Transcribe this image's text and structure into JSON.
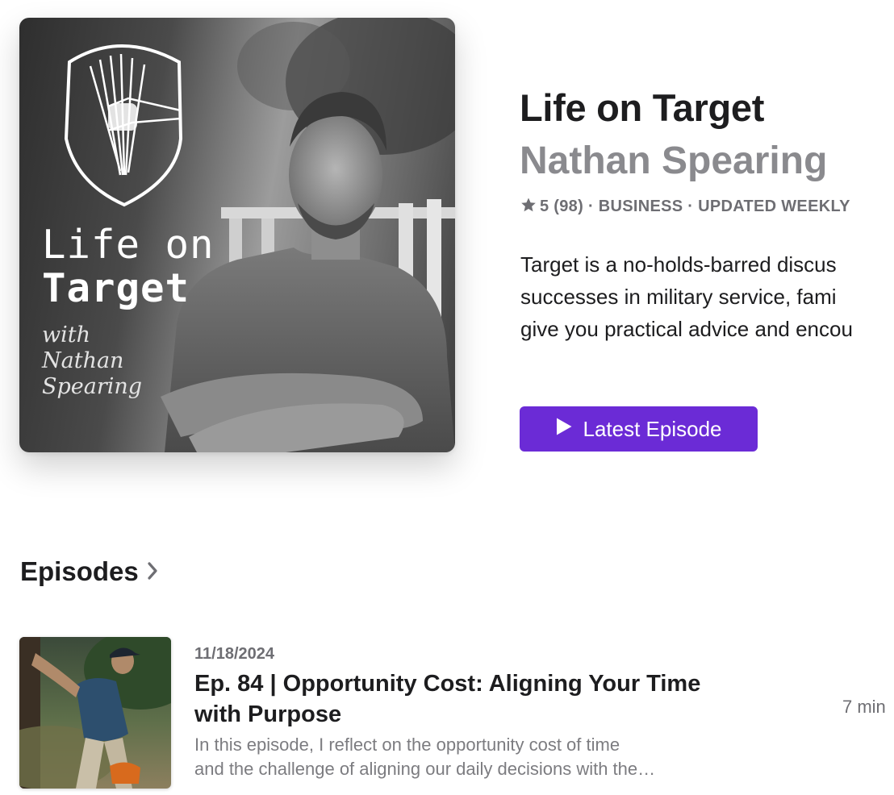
{
  "artwork": {
    "title_line1": "Life on",
    "title_line2": "Target",
    "with_line1": "with",
    "with_line2": "Nathan",
    "with_line3": "Spearing",
    "logo_icon": "shield-arrows-fist-logo"
  },
  "podcast": {
    "title": "Life on Target",
    "author": "Nathan Spearing",
    "rating": "5",
    "rating_count": "(98)",
    "category": "BUSINESS",
    "update_frequency": "UPDATED WEEKLY",
    "description_lines": [
      "Target is a no-holds-barred discus",
      "successes in military service, fami",
      "give you practical advice and encou"
    ]
  },
  "latest_button": {
    "label": "Latest Episode",
    "icon": "play-icon"
  },
  "episodes_section": {
    "title": "Episodes",
    "icon": "chevron-right-icon"
  },
  "episodes": [
    {
      "date": "11/18/2024",
      "title": "Ep. 84 | Opportunity Cost: Aligning Your Time with Purpose",
      "summary_line1": "In this episode, I reflect on the opportunity cost of time",
      "summary_line2": "and the challenge of aligning our daily decisions with the…",
      "duration": "7 min"
    }
  ],
  "colors": {
    "accent": "#6b2bd6",
    "text_primary": "#1d1d1f",
    "text_secondary": "#8a8a8e",
    "text_meta": "#6e6e73"
  }
}
